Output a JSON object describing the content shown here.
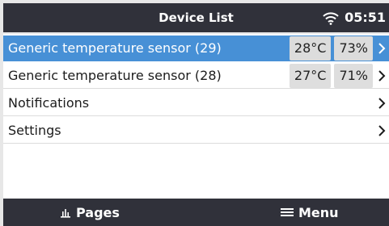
{
  "header": {
    "title": "Device List",
    "time": "05:51",
    "wifi_icon": "wifi-icon"
  },
  "list": {
    "items": [
      {
        "label": "Generic temperature sensor (29)",
        "temperature": "28°C",
        "humidity": "73%",
        "selected": true
      },
      {
        "label": "Generic temperature sensor (28)",
        "temperature": "27°C",
        "humidity": "71%",
        "selected": false
      },
      {
        "label": "Notifications",
        "selected": false
      },
      {
        "label": "Settings",
        "selected": false
      }
    ]
  },
  "footer": {
    "pages_label": "Pages",
    "menu_label": "Menu",
    "pages_icon": "bar-chart-icon",
    "menu_icon": "hamburger-icon"
  },
  "colors": {
    "bar": "#30313a",
    "selected": "#4790d6",
    "background": "#e7e7e7"
  }
}
